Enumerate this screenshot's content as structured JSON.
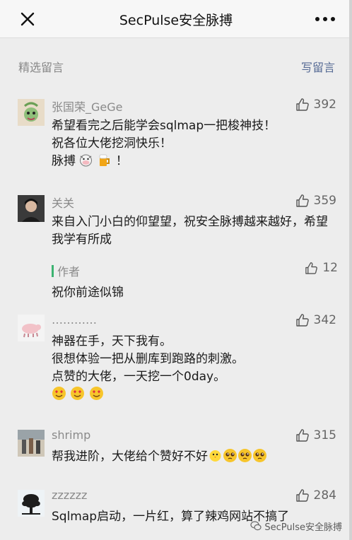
{
  "header": {
    "title": "SecPulse安全脉搏",
    "close_icon": "close-icon",
    "more_icon": "more-icon"
  },
  "section": {
    "label": "精选留言",
    "write_label": "写留言"
  },
  "comments": [
    {
      "nickname": "张国荣_GeGe",
      "likes": "392",
      "lines": [
        "希望看完之后能学会sqlmap一把梭神技！",
        "祝各位大佬挖洞快乐！",
        "脉搏"
      ],
      "suffix_emoji": [
        "cow-emoji",
        "beer-emoji"
      ],
      "suffix_text": "！"
    },
    {
      "nickname": "关关",
      "likes": "359",
      "text": "来自入门小白的仰望望，祝安全脉搏越来越好，希望我学有所成",
      "reply": {
        "author": "作者",
        "likes": "12",
        "text": "祝你前途似锦"
      }
    },
    {
      "nickname": "…………",
      "likes": "342",
      "lines": [
        "神器在手，天下我有。",
        "很想体验一把从删库到跑路的刺激。",
        "点赞的大佬，一天挖一个0day。"
      ],
      "emoji": [
        "heart-eyes-emoji",
        "heart-eyes-emoji",
        "heart-eyes-emoji"
      ]
    },
    {
      "nickname": "shrimp",
      "likes": "315",
      "text": "帮我进阶，大佬给个赞好不好",
      "emoji": [
        "chick-emoji",
        "pleading-emoji",
        "pleading-emoji",
        "pleading-emoji"
      ]
    },
    {
      "nickname": "zzzzzz",
      "likes": "284",
      "text": "Sqlmap启动，一片红，算了辣鸡网站不搞了"
    }
  ],
  "watermark": {
    "text": "SecPulse安全脉搏"
  },
  "colors": {
    "background": "#ededed",
    "link": "#576b95",
    "author_bar": "#3cb371"
  }
}
